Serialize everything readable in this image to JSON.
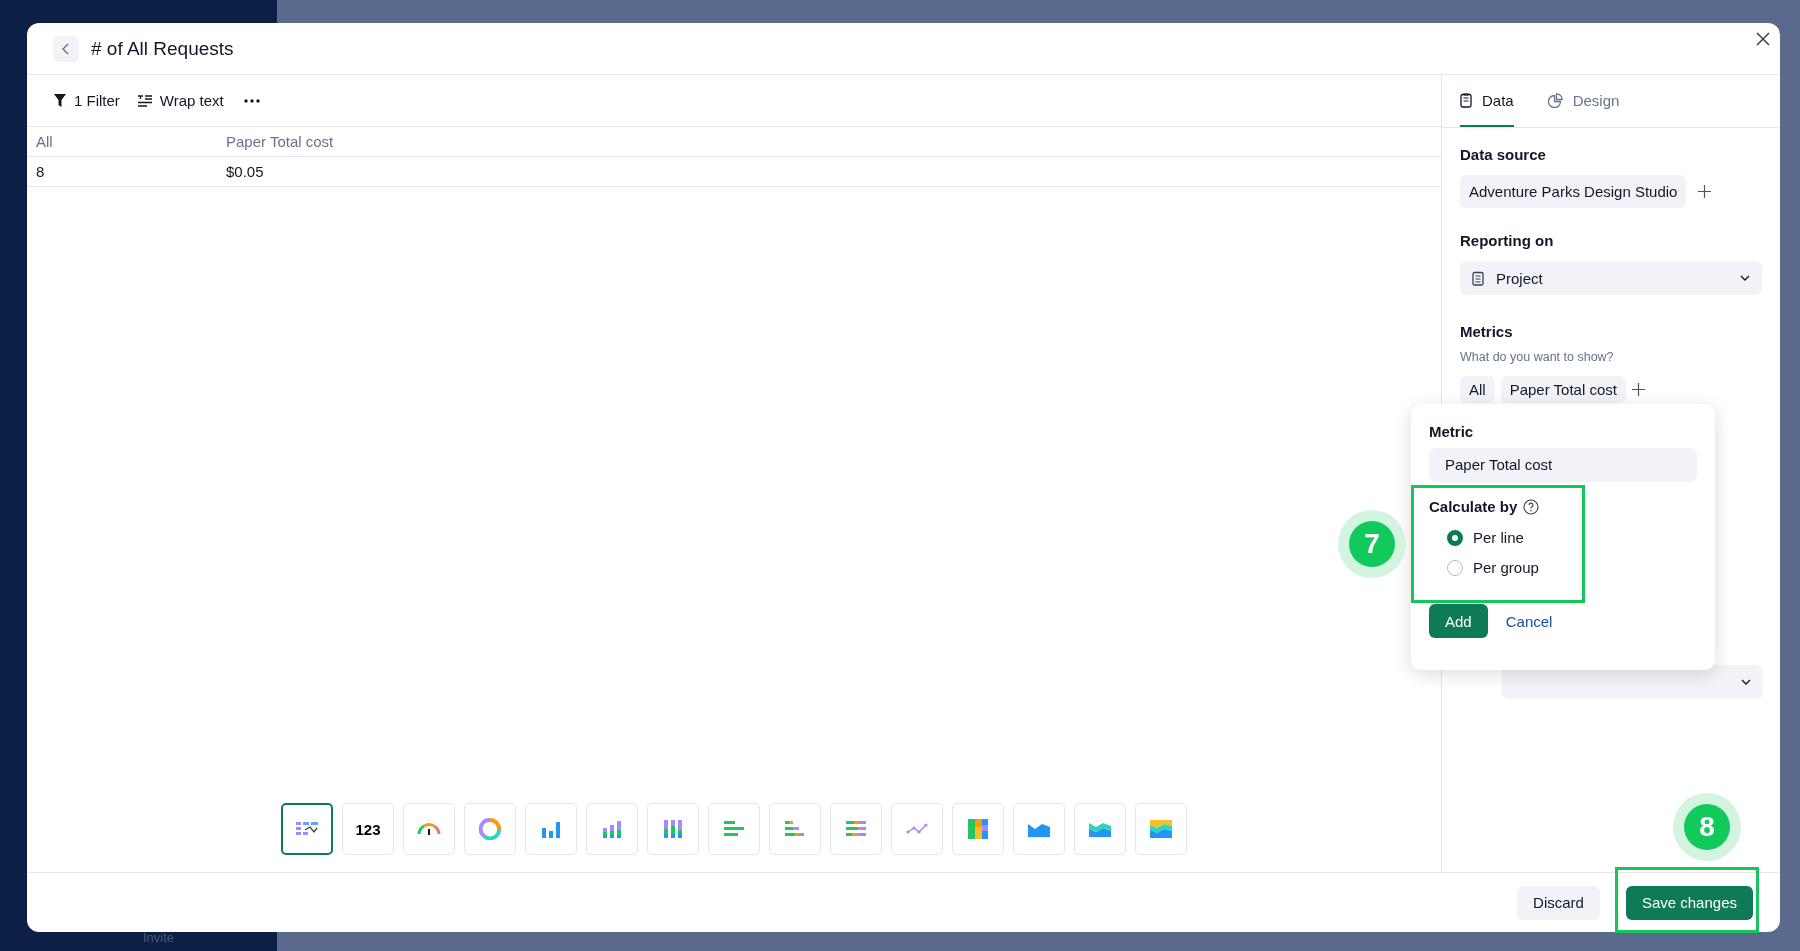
{
  "backdrop": {
    "invite": "Invite"
  },
  "modal": {
    "title": "# of All Requests"
  },
  "toolbar": {
    "filter": "1 Filter",
    "wrap": "Wrap text"
  },
  "table": {
    "columns": [
      "All",
      "Paper Total cost"
    ],
    "rows": [
      [
        "8",
        "$0.05"
      ]
    ]
  },
  "chart_types": [
    {
      "kind": "table",
      "selected": true
    },
    {
      "kind": "number",
      "label": "123",
      "selected": false
    },
    {
      "kind": "gauge",
      "selected": false
    },
    {
      "kind": "donut",
      "selected": false
    },
    {
      "kind": "bar",
      "selected": false
    },
    {
      "kind": "stacked-bar",
      "selected": false
    },
    {
      "kind": "full-bar",
      "selected": false
    },
    {
      "kind": "hbar",
      "selected": false
    },
    {
      "kind": "stacked-hbar",
      "selected": false
    },
    {
      "kind": "full-hbar",
      "selected": false
    },
    {
      "kind": "line",
      "selected": false
    },
    {
      "kind": "treemap",
      "selected": false
    },
    {
      "kind": "area",
      "selected": false
    },
    {
      "kind": "stacked-area",
      "selected": false
    },
    {
      "kind": "full-area",
      "selected": false
    }
  ],
  "panel": {
    "tabs": [
      {
        "label": "Data",
        "kind": "data",
        "selected": true
      },
      {
        "label": "Design",
        "kind": "design",
        "selected": false
      }
    ],
    "data_source": {
      "label": "Data source",
      "value": "Adventure Parks Design Studio"
    },
    "reporting_on": {
      "label": "Reporting on",
      "value": "Project"
    },
    "metrics": {
      "label": "Metrics",
      "hint": "What do you want to show?",
      "chips": [
        "All",
        "Paper Total cost"
      ]
    }
  },
  "popover": {
    "metric_label": "Metric",
    "metric_value": "Paper Total cost",
    "calc_label": "Calculate by",
    "options": [
      {
        "label": "Per line",
        "selected": true
      },
      {
        "label": "Per group",
        "selected": false
      }
    ],
    "add": "Add",
    "cancel": "Cancel"
  },
  "footer": {
    "discard": "Discard",
    "save": "Save changes"
  },
  "steps": [
    "7",
    "8"
  ]
}
